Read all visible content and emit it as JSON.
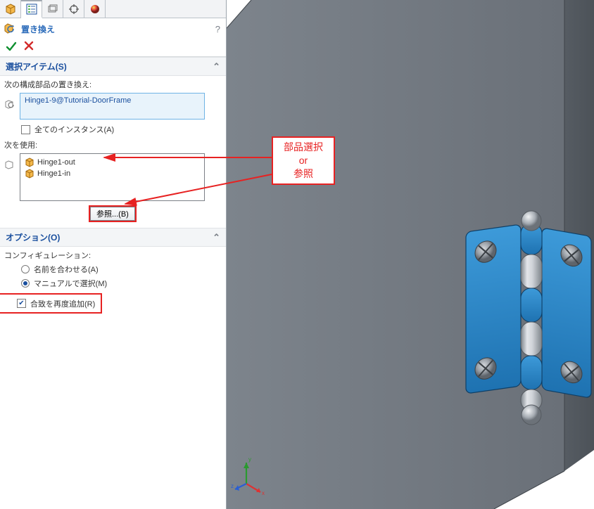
{
  "command": {
    "title": "置き換え",
    "help": "?"
  },
  "sections": {
    "select_items": {
      "header": "選択アイテム(S)",
      "replace_label": "次の構成部品の置き換え:",
      "selected_component": "Hinge1-9@Tutorial-DoorFrame",
      "all_instances_label": "全てのインスタンス(A)",
      "all_instances_checked": false,
      "use_label": "次を使用:",
      "use_items": [
        "Hinge1-out",
        "Hinge1-in"
      ],
      "browse_label": "参照...(B)"
    },
    "options": {
      "header": "オプション(O)",
      "config_label": "コンフィギュレーション:",
      "radio_name": "名前を合わせる(A)",
      "radio_manual": "マニュアルで選択(M)",
      "radio_selected": "manual",
      "readd_label": "合致を再度追加(R)",
      "readd_checked": true
    }
  },
  "annotation": {
    "line1": "部品選択",
    "line2": "or",
    "line3": "参照"
  },
  "colors": {
    "highlight": "#e72222",
    "link_blue": "#1a4f9e",
    "selbox_border": "#6fb3e5",
    "selbox_bg": "#e8f3fb",
    "hinge_plate": "#2b88cb",
    "hinge_barrel": "#bfc5cc",
    "door": "#6b7178"
  },
  "triad": {
    "x": "x",
    "y": "y",
    "z": "z"
  }
}
